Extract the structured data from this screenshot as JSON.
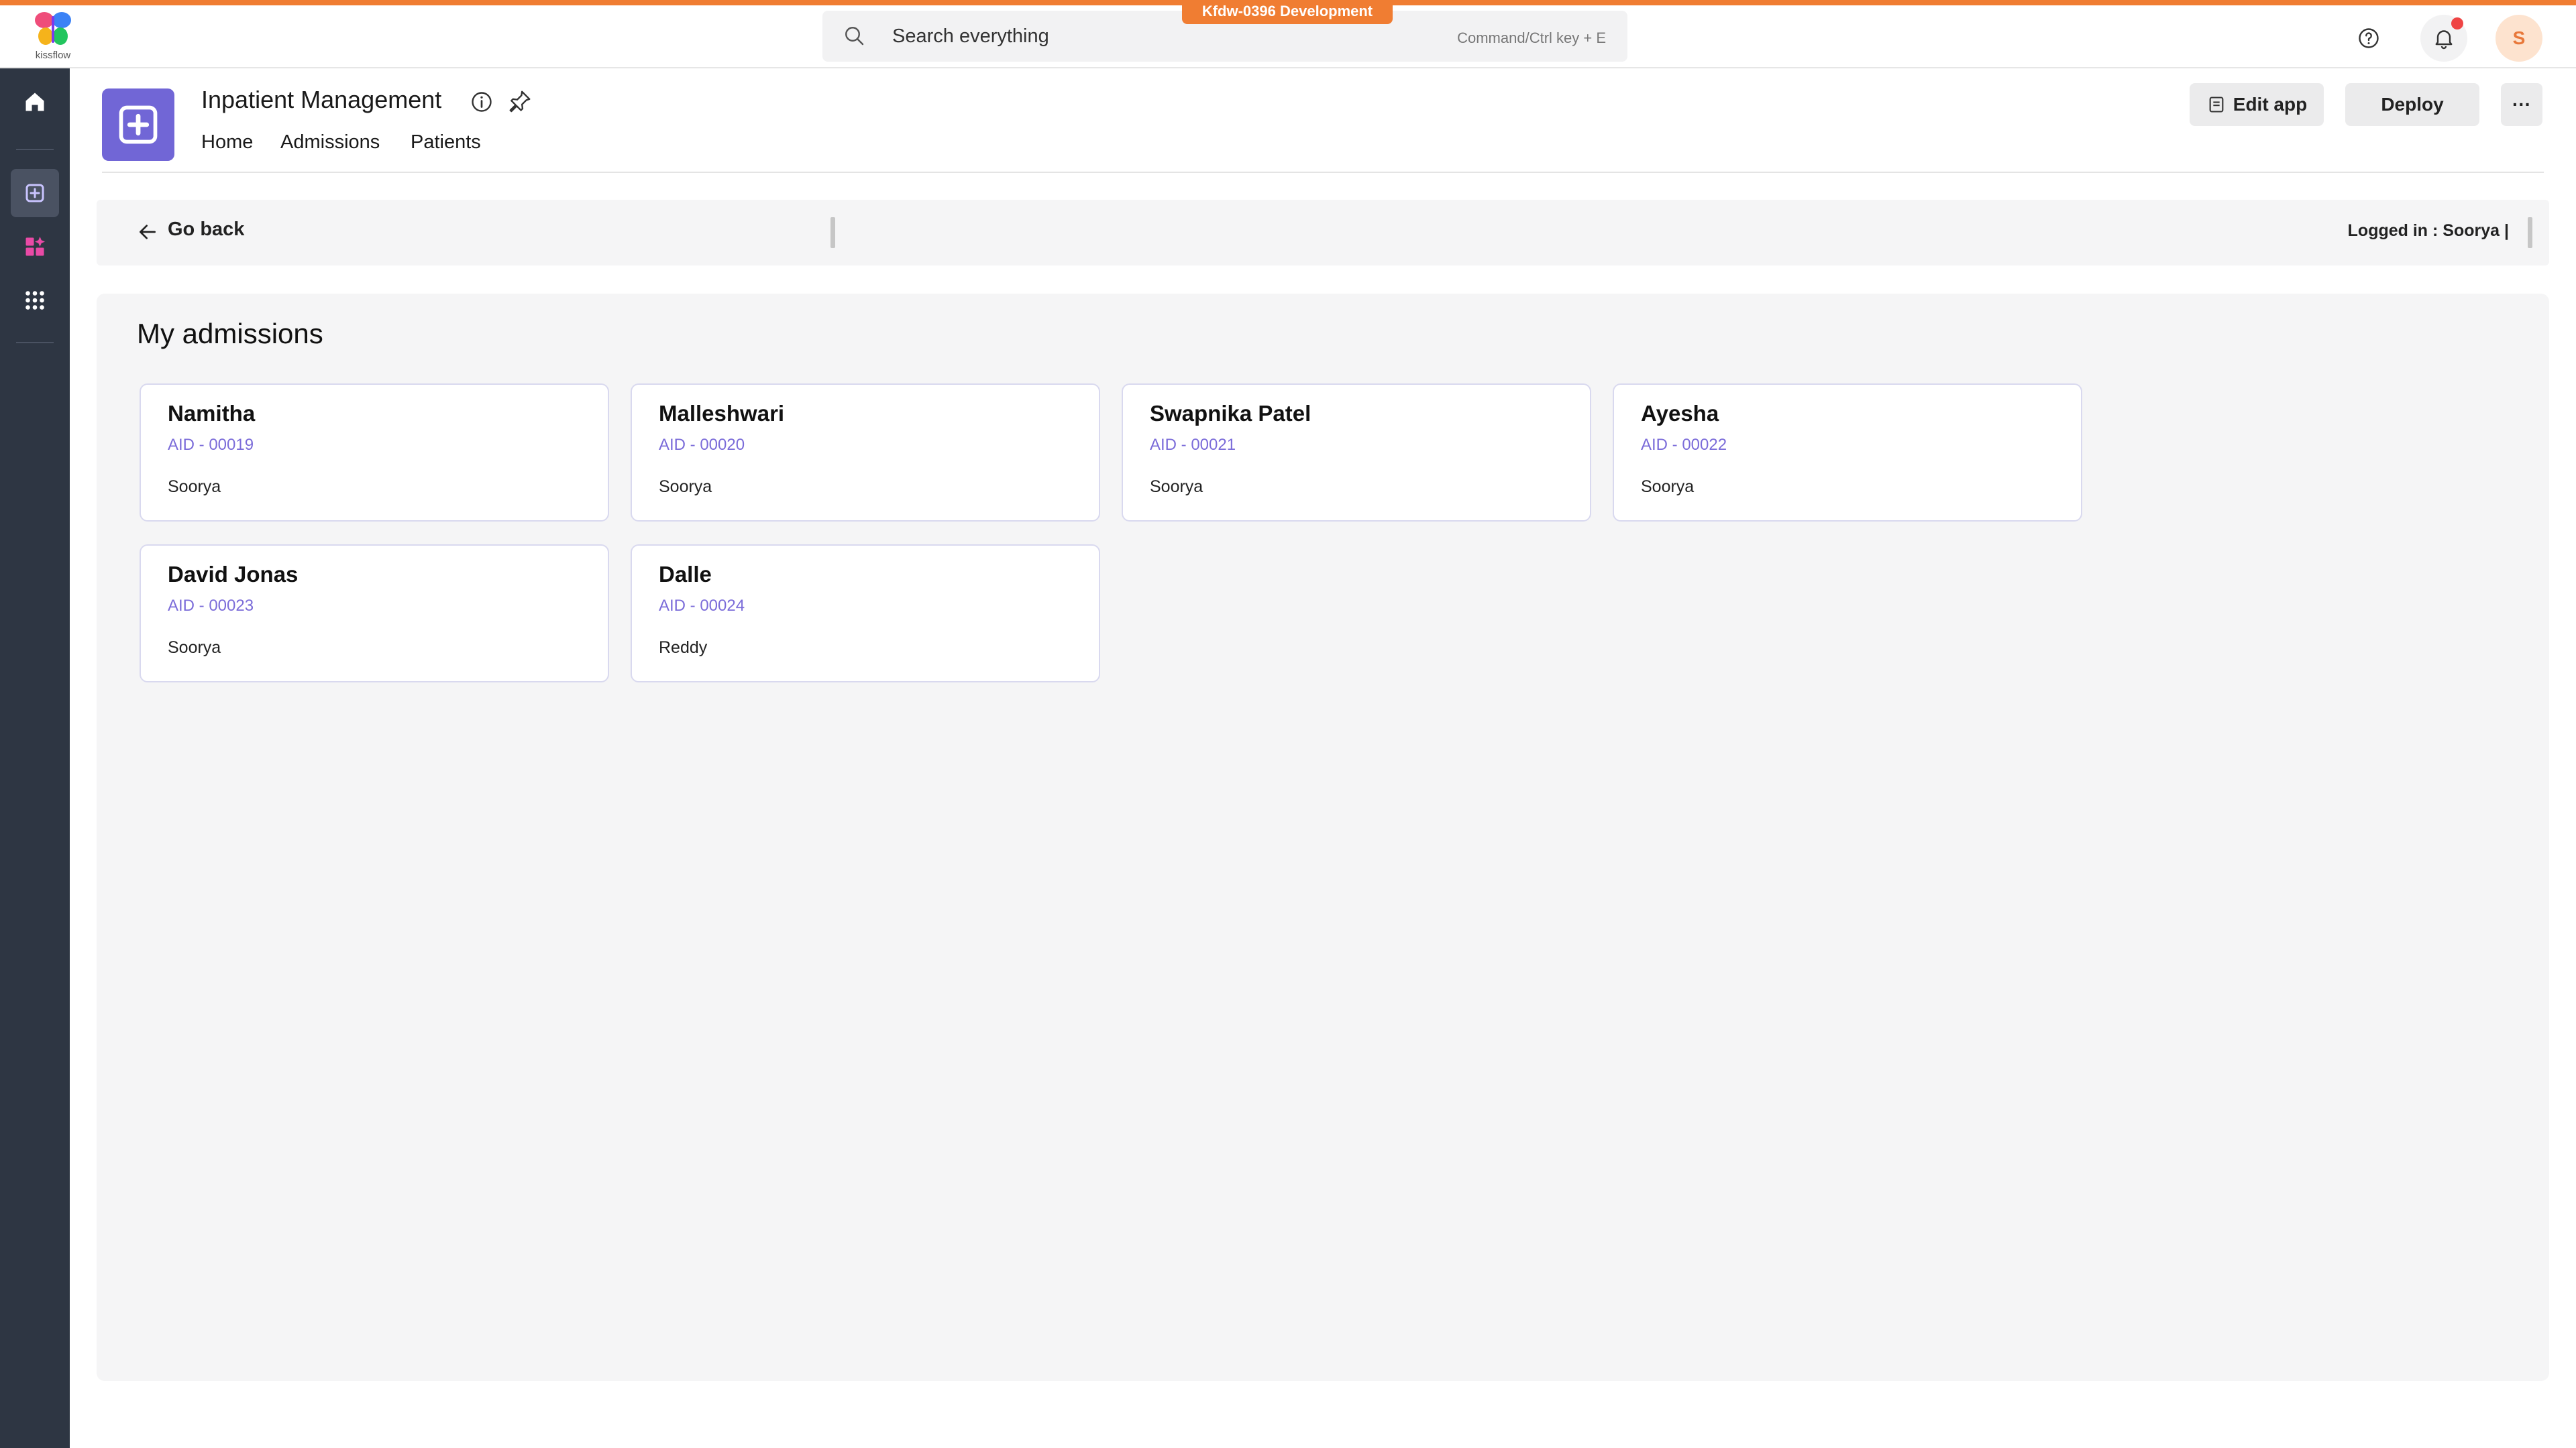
{
  "topbar": {
    "logo_text": "kissflow",
    "environment": "Kfdw-0396 Development",
    "search_placeholder": "Search everything",
    "search_shortcut": "Command/Ctrl key + E",
    "avatar_initial": "S",
    "accent_color": "#f07d32"
  },
  "app": {
    "title": "Inpatient Management",
    "tabs": [
      "Home",
      "Admissions",
      "Patients"
    ],
    "edit_label": "Edit app",
    "deploy_label": "Deploy",
    "more_label": "···",
    "icon_color": "#7166d6"
  },
  "page": {
    "go_back": "Go back",
    "logged_in": "Logged in : Soorya |",
    "section_title": "My admissions"
  },
  "admissions": [
    {
      "name": "Namitha",
      "aid": "AID - 00019",
      "owner": "Soorya"
    },
    {
      "name": "Malleshwari",
      "aid": "AID - 00020",
      "owner": "Soorya"
    },
    {
      "name": "Swapnika Patel",
      "aid": "AID - 00021",
      "owner": "Soorya"
    },
    {
      "name": "Ayesha",
      "aid": "AID - 00022",
      "owner": "Soorya"
    },
    {
      "name": "David Jonas",
      "aid": "AID - 00023",
      "owner": "Soorya"
    },
    {
      "name": "Dalle",
      "aid": "AID - 00024",
      "owner": "Reddy"
    }
  ]
}
